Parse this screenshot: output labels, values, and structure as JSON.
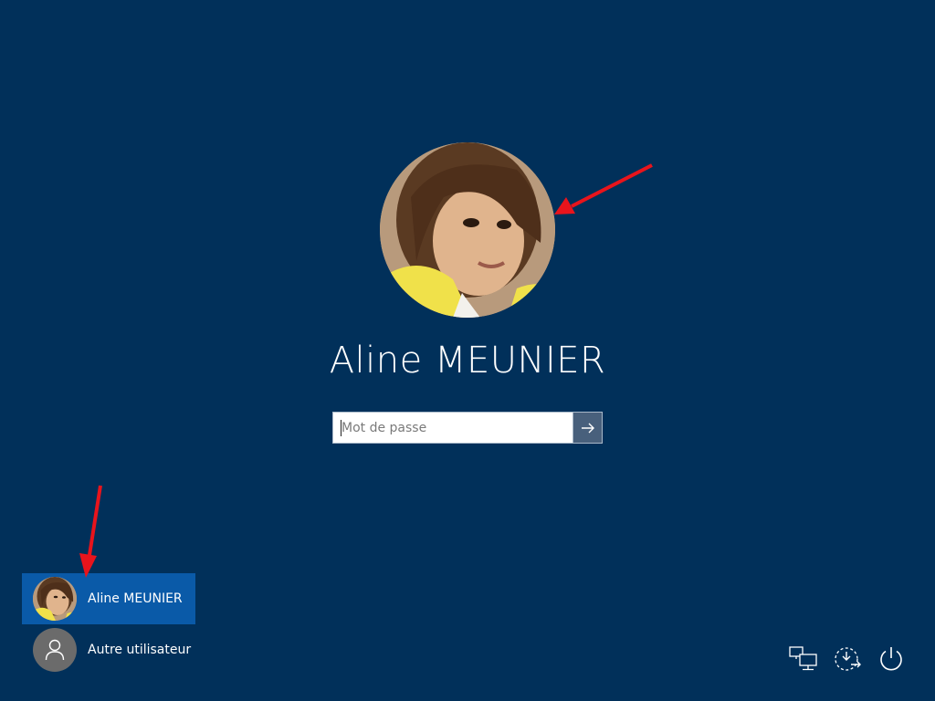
{
  "login": {
    "user_name": "Aline MEUNIER",
    "password_placeholder": "Mot de passe",
    "password_value": ""
  },
  "user_switcher": {
    "users": [
      {
        "label": "Aline MEUNIER",
        "selected": true
      },
      {
        "label": "Autre utilisateur",
        "selected": false
      }
    ]
  },
  "system_icons": [
    "network-icon",
    "ease-of-access-icon",
    "power-icon"
  ],
  "colors": {
    "background": "#01305a",
    "selected_tile": "#0a5aa8",
    "submit_button": "#48607c",
    "annotation_arrow": "#e8141c"
  }
}
